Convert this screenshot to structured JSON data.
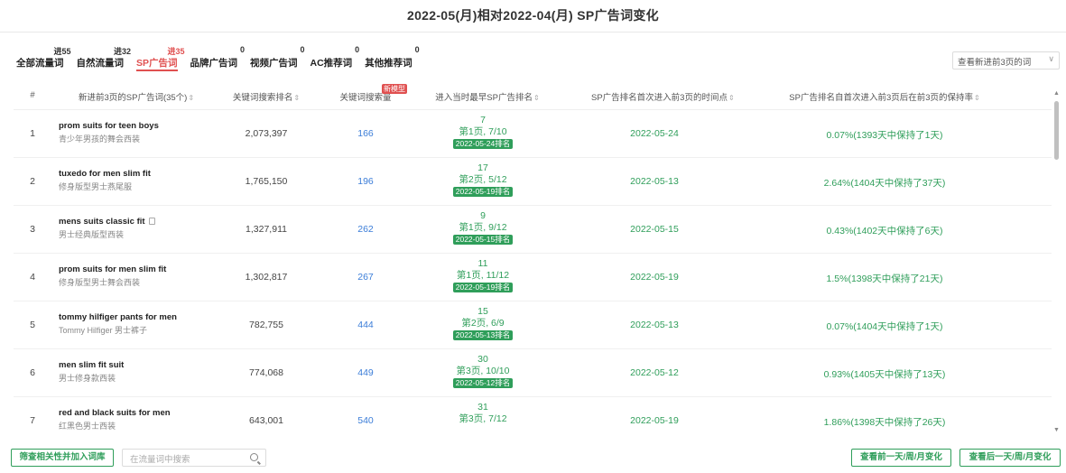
{
  "page_title": "2022-05(月)相对2022-04(月) SP广告词变化",
  "tabs": [
    {
      "label": "全部流量词",
      "badge": "进55",
      "active": false
    },
    {
      "label": "自然流量词",
      "badge": "进32",
      "active": false
    },
    {
      "label": "SP广告词",
      "badge": "进35",
      "active": true
    },
    {
      "label": "品牌广告词",
      "badge": "0",
      "active": false
    },
    {
      "label": "视频广告词",
      "badge": "0",
      "active": false
    },
    {
      "label": "AC推荐词",
      "badge": "0",
      "active": false
    },
    {
      "label": "其他推荐词",
      "badge": "0",
      "active": false
    }
  ],
  "view_select": {
    "value": "查看新进前3页的词"
  },
  "table": {
    "headers": {
      "index": "#",
      "keyword": "新进前3页的SP广告词(35个)",
      "search_rank": "关键词搜索排名",
      "search_volume": "关键词搜索量",
      "search_volume_tag": "新模型",
      "sp_rank": "进入当时最早SP广告排名",
      "first_date": "SP广告排名首次进入前3页的时间点",
      "keep_rate": "SP广告排名自首次进入前3页后在前3页的保持率"
    },
    "rows": [
      {
        "index": "1",
        "kw_en": "prom suits for teen boys",
        "kw_cn": "青少年男孩的舞会西装",
        "rank": "2,073,397",
        "volume": "166",
        "sp_pos": "7",
        "sp_page": "第1页, 7/10",
        "sp_tag": "2022-05-24排名",
        "date": "2022-05-24",
        "keep": "0.07%(1393天中保持了1天)"
      },
      {
        "index": "2",
        "kw_en": "tuxedo for men slim fit",
        "kw_cn": "修身版型男士燕尾服",
        "rank": "1,765,150",
        "volume": "196",
        "sp_pos": "17",
        "sp_page": "第2页, 5/12",
        "sp_tag": "2022-05-19排名",
        "date": "2022-05-13",
        "keep": "2.64%(1404天中保持了37天)"
      },
      {
        "index": "3",
        "kw_en": "mens suits classic fit",
        "kw_cn": "男士经典版型西装",
        "rank": "1,327,911",
        "volume": "262",
        "sp_pos": "9",
        "sp_page": "第1页, 9/12",
        "sp_tag": "2022-05-15排名",
        "date": "2022-05-15",
        "keep": "0.43%(1402天中保持了6天)"
      },
      {
        "index": "4",
        "kw_en": "prom suits for men slim fit",
        "kw_cn": "修身版型男士舞会西装",
        "rank": "1,302,817",
        "volume": "267",
        "sp_pos": "11",
        "sp_page": "第1页, 11/12",
        "sp_tag": "2022-05-19排名",
        "date": "2022-05-19",
        "keep": "1.5%(1398天中保持了21天)"
      },
      {
        "index": "5",
        "kw_en": "tommy hilfiger pants for men",
        "kw_cn": "Tommy Hilfiger 男士裤子",
        "rank": "782,755",
        "volume": "444",
        "sp_pos": "15",
        "sp_page": "第2页, 6/9",
        "sp_tag": "2022-05-13排名",
        "date": "2022-05-13",
        "keep": "0.07%(1404天中保持了1天)"
      },
      {
        "index": "6",
        "kw_en": "men slim fit suit",
        "kw_cn": "男士修身款西装",
        "rank": "774,068",
        "volume": "449",
        "sp_pos": "30",
        "sp_page": "第3页, 10/10",
        "sp_tag": "2022-05-12排名",
        "date": "2022-05-12",
        "keep": "0.93%(1405天中保持了13天)"
      },
      {
        "index": "7",
        "kw_en": "red and black suits for men",
        "kw_cn": "红黑色男士西装",
        "rank": "643,001",
        "volume": "540",
        "sp_pos": "31",
        "sp_page": "第3页, 7/12",
        "sp_tag": "",
        "date": "2022-05-19",
        "keep": "1.86%(1398天中保持了26天)"
      }
    ]
  },
  "footer": {
    "filter_button": "筛查相关性并加入词库",
    "search_placeholder": "在流量词中搜索",
    "prev_button": "查看前一天/周/月变化",
    "next_button": "查看后一天/周/月变化"
  }
}
